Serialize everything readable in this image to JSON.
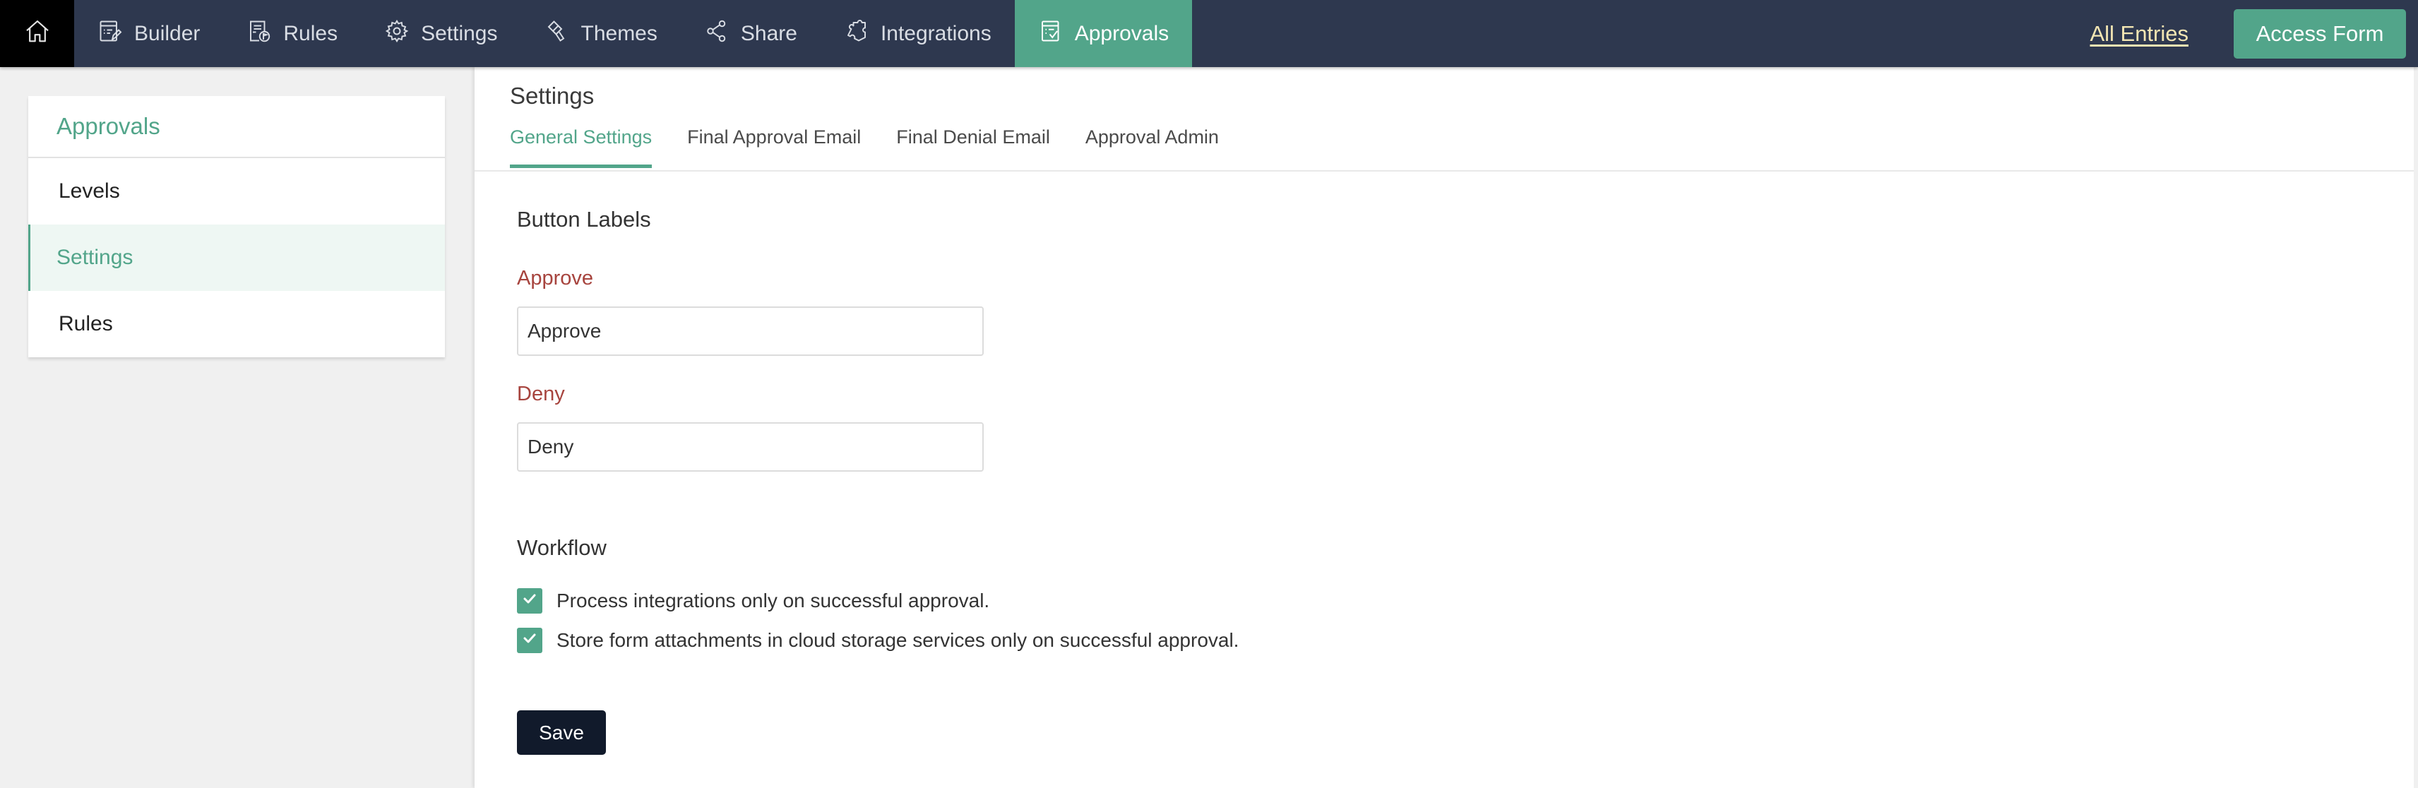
{
  "nav": {
    "home_icon": "home-icon",
    "items": [
      {
        "label": "Builder",
        "icon": "builder-icon",
        "active": false
      },
      {
        "label": "Rules",
        "icon": "rules-icon",
        "active": false
      },
      {
        "label": "Settings",
        "icon": "gear-icon",
        "active": false
      },
      {
        "label": "Themes",
        "icon": "paint-brush-icon",
        "active": false
      },
      {
        "label": "Share",
        "icon": "share-icon",
        "active": false
      },
      {
        "label": "Integrations",
        "icon": "puzzle-icon",
        "active": false
      },
      {
        "label": "Approvals",
        "icon": "approvals-icon",
        "active": true
      }
    ],
    "all_entries_label": "All Entries",
    "access_form_label": "Access Form"
  },
  "sidebar": {
    "title": "Approvals",
    "items": [
      {
        "label": "Levels",
        "active": false
      },
      {
        "label": "Settings",
        "active": true
      },
      {
        "label": "Rules",
        "active": false
      }
    ]
  },
  "main": {
    "title": "Settings",
    "tabs": [
      {
        "label": "General Settings",
        "active": true
      },
      {
        "label": "Final Approval Email",
        "active": false
      },
      {
        "label": "Final Denial Email",
        "active": false
      },
      {
        "label": "Approval Admin",
        "active": false
      }
    ],
    "button_labels": {
      "heading": "Button Labels",
      "approve": {
        "label": "Approve",
        "value": "Approve"
      },
      "deny": {
        "label": "Deny",
        "value": "Deny"
      }
    },
    "workflow": {
      "heading": "Workflow",
      "options": [
        {
          "label": "Process integrations only on successful approval.",
          "checked": true
        },
        {
          "label": "Store form attachments in cloud storage services only on successful approval.",
          "checked": true
        }
      ]
    },
    "save_label": "Save"
  },
  "colors": {
    "nav_bg": "#2e384f",
    "accent": "#52a58a",
    "field_label": "#a7443e",
    "save_bg": "#111a2b",
    "all_entries": "#f3e6b3"
  }
}
